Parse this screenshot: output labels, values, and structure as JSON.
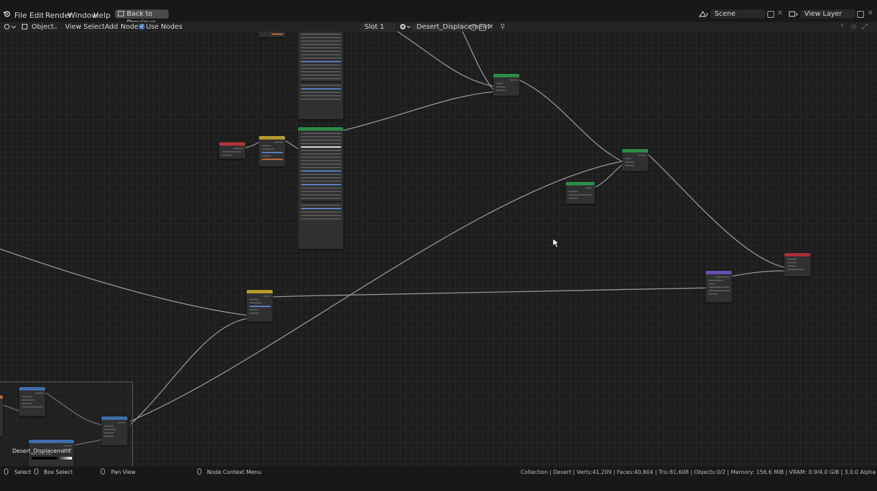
{
  "menubar": {
    "items": [
      "File",
      "Edit",
      "Render",
      "Window",
      "Help"
    ],
    "back_button": "Back to Previous",
    "scene": "Scene",
    "view_layer": "View Layer"
  },
  "header": {
    "mode": "Object",
    "menus": [
      "View",
      "Select",
      "Add",
      "Node"
    ],
    "use_nodes_label": "Use Nodes",
    "use_nodes_checked": true,
    "slot": "Slot 1",
    "material": "Desert_Displacement"
  },
  "canvas": {
    "frame_label": "Desert_Displacement"
  },
  "statusbar": {
    "select": "Select",
    "box_select": "Box Select",
    "pan_view": "Pan View",
    "context_menu": "Node Context Menu",
    "stats": "Collection | Desert | Verts:41,209 | Faces:40,804 | Tris:81,608 | Objects:0/2 | Memory: 156.6 MiB | VRAM: 0.9/4.0 GiB | 3.0.0 Alpha"
  },
  "colors": {
    "accent": "#4772b3",
    "shader_header": "#2e8b45",
    "input_header": "#b0353a",
    "vector_header": "#6a4fb5",
    "color_header": "#b59a2e",
    "converter_header": "#3e6ea8",
    "output_header": "#a82e3a"
  }
}
